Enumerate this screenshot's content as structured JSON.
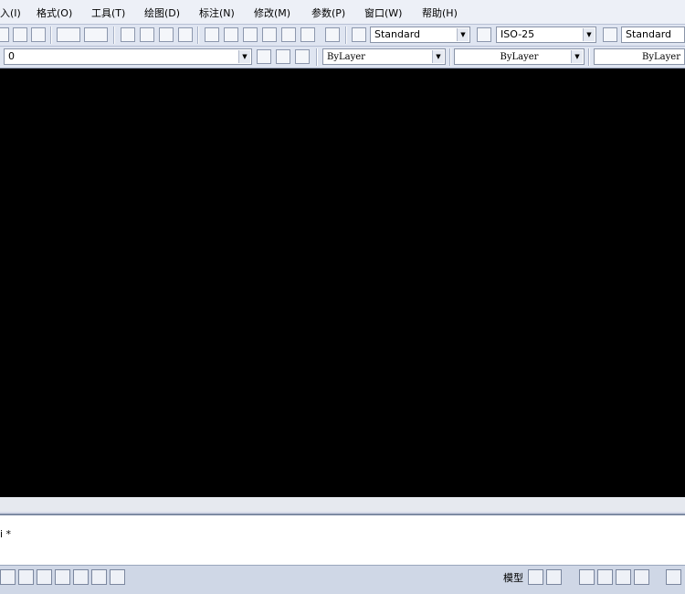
{
  "menubar": {
    "items": [
      "入(I)",
      "格式(O)",
      "工具(T)",
      "绘图(D)",
      "标注(N)",
      "修改(M)",
      "参数(P)",
      "窗口(W)",
      "帮助(H)"
    ]
  },
  "toolbar_styles": {
    "text_style": "Standard",
    "dim_style": "ISO-25",
    "table_style": "Standard"
  },
  "toolbar_layers": {
    "current_layer": "0",
    "color": "ByLayer",
    "linetype": "ByLayer",
    "lineweight": "ByLayer"
  },
  "command_line": {
    "text": "i *"
  },
  "statusbar": {
    "model_tab": "模型"
  }
}
